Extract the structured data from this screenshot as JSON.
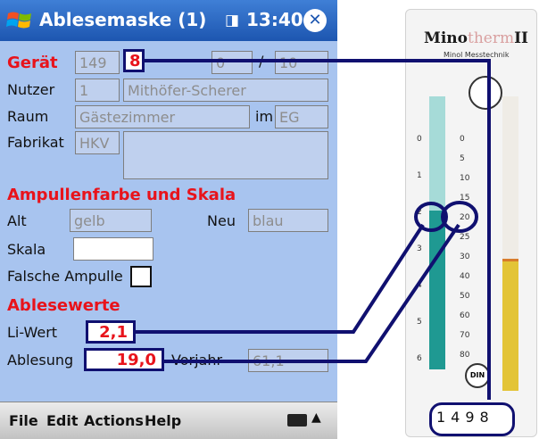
{
  "app": {
    "title": "Ablesemaske (1)",
    "clock": "13:40",
    "status_icon": "signal-icon",
    "close_icon": "close-icon",
    "close_glyph": "✕"
  },
  "form": {
    "geraet": {
      "label": "Gerät",
      "value1": "149",
      "value2": "8",
      "value3": "0",
      "sep": "/",
      "value4": "10"
    },
    "nutzer": {
      "label": "Nutzer",
      "value1": "1",
      "value2": "Mithöfer-Scherer"
    },
    "raum": {
      "label": "Raum",
      "value": "Gästezimmer",
      "im_label": "im",
      "floor": "EG"
    },
    "fabrikat": {
      "label": "Fabrikat",
      "value": "HKV"
    },
    "ampullen": {
      "section_label": "Ampullenfarbe und Skala",
      "alt_label": "Alt",
      "alt_value": "gelb",
      "neu_label": "Neu",
      "neu_value": "blau",
      "skala_label": "Skala",
      "skala_value": "",
      "falsche_label": "Falsche Ampulle"
    },
    "ablesewerte": {
      "section_label": "Ablesewerte",
      "li_label": "Li-Wert",
      "li_value": "2,1",
      "ablesung_label": "Ablesung",
      "ablesung_value": "19,0",
      "vorjahr_label": "Vorjahr",
      "vorjahr_value": "61,1"
    }
  },
  "menubar": {
    "file": "File",
    "edit": "Edit",
    "actions": "Actions",
    "help": "Help",
    "up_arrow": "▲"
  },
  "meter": {
    "brand_left": "Mino",
    "brand_mid": "therm",
    "brand_right": "II",
    "subbrand": "Minol Messtechnik",
    "left_scale": [
      "0",
      "1",
      "2",
      "3",
      "4",
      "5",
      "6"
    ],
    "right_scale": [
      "0",
      "5",
      "10",
      "15",
      "20",
      "25",
      "30",
      "40",
      "50",
      "60",
      "70",
      "80"
    ],
    "din": "DIN",
    "serial": "1498"
  },
  "colors": {
    "titlebar": "#1d56b0",
    "form_bg": "#a8c4ef",
    "highlight_border": "#101070",
    "label_red": "#e8131b",
    "left_tube": "#1f9992",
    "right_tube": "#e3c437"
  }
}
